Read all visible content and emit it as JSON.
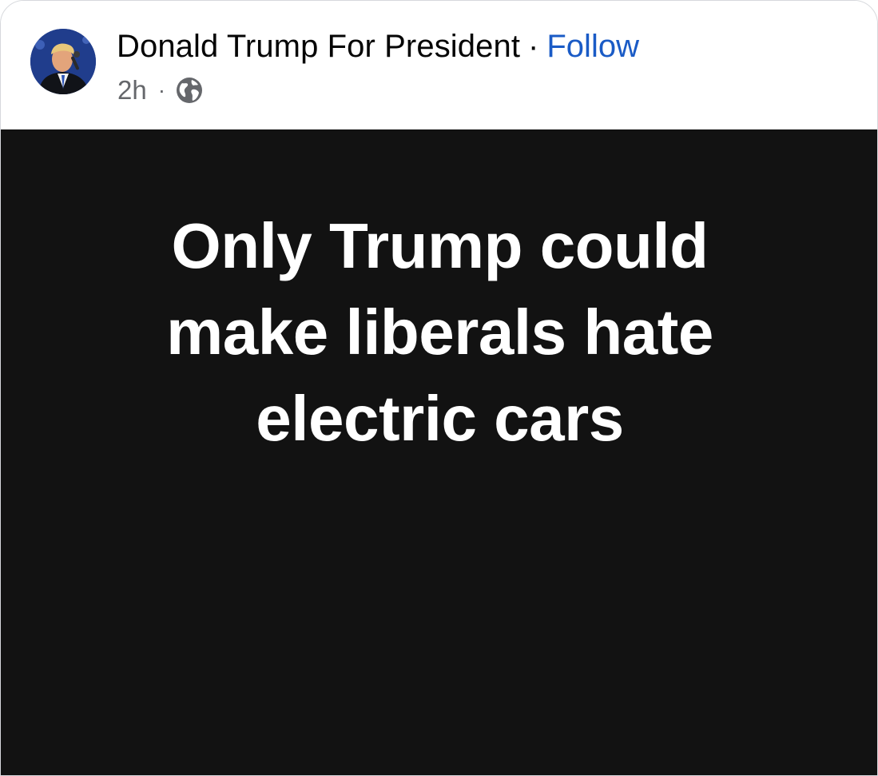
{
  "post": {
    "author": "Donald Trump For President",
    "separator": "·",
    "follow_label": "Follow",
    "timestamp": "2h",
    "meta_separator": "·",
    "visibility_icon": "globe-icon",
    "image_text_lines": [
      "Only Trump could",
      "make liberals hate",
      "electric cars"
    ]
  },
  "colors": {
    "follow_link": "#1a5bc6",
    "meta_text": "#65676b",
    "image_background": "#121212",
    "image_text": "#ffffff"
  }
}
